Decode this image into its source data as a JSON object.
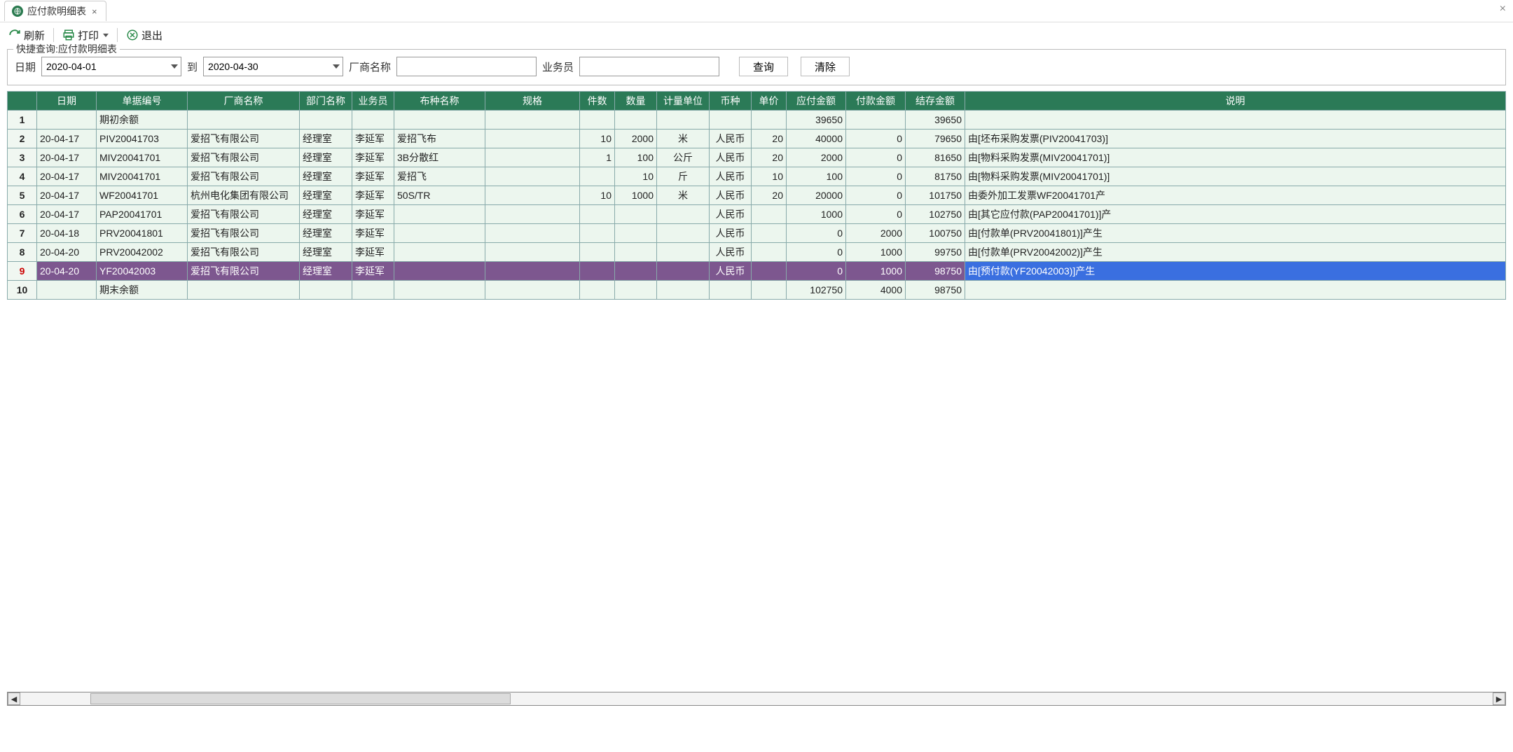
{
  "tab": {
    "title": "应付款明细表"
  },
  "toolbar": {
    "refresh": "刷新",
    "print": "打印",
    "exit": "退出"
  },
  "query": {
    "legend": "快捷查询:应付款明细表",
    "label_date": "日期",
    "date_from": "2020-04-01",
    "label_to": "到",
    "date_to": "2020-04-30",
    "label_supplier": "厂商名称",
    "supplier": "",
    "label_sales": "业务员",
    "sales": "",
    "btn_query": "查询",
    "btn_clear": "清除"
  },
  "grid": {
    "columns": [
      "日期",
      "单据编号",
      "厂商名称",
      "部门名称",
      "业务员",
      "布种名称",
      "规格",
      "件数",
      "数量",
      "计量单位",
      "币种",
      "单价",
      "应付金额",
      "付款金额",
      "结存金额",
      "说明"
    ],
    "selected_row": 9,
    "rows": [
      {
        "n": 1,
        "date": "",
        "doc": "期初余额",
        "supplier": "",
        "dept": "",
        "sales": "",
        "cloth": "",
        "spec": "",
        "pcs": "",
        "qty": "",
        "uom": "",
        "curr": "",
        "price": "",
        "pay": "39650",
        "paid": "",
        "bal": "39650",
        "desc": ""
      },
      {
        "n": 2,
        "date": "20-04-17",
        "doc": "PIV20041703",
        "supplier": "爱招飞有限公司",
        "dept": "经理室",
        "sales": "李延军",
        "cloth": "爱招飞布",
        "spec": "",
        "pcs": "10",
        "qty": "2000",
        "uom": "米",
        "curr": "人民币",
        "price": "20",
        "pay": "40000",
        "paid": "0",
        "bal": "79650",
        "desc": "由[坯布采购发票(PIV20041703)]"
      },
      {
        "n": 3,
        "date": "20-04-17",
        "doc": "MIV20041701",
        "supplier": "爱招飞有限公司",
        "dept": "经理室",
        "sales": "李延军",
        "cloth": "3B分散红",
        "spec": "",
        "pcs": "1",
        "qty": "100",
        "uom": "公斤",
        "curr": "人民币",
        "price": "20",
        "pay": "2000",
        "paid": "0",
        "bal": "81650",
        "desc": "由[物料采购发票(MIV20041701)]"
      },
      {
        "n": 4,
        "date": "20-04-17",
        "doc": "MIV20041701",
        "supplier": "爱招飞有限公司",
        "dept": "经理室",
        "sales": "李延军",
        "cloth": "爱招飞",
        "spec": "",
        "pcs": "",
        "qty": "10",
        "uom": "斤",
        "curr": "人民币",
        "price": "10",
        "pay": "100",
        "paid": "0",
        "bal": "81750",
        "desc": "由[物料采购发票(MIV20041701)]"
      },
      {
        "n": 5,
        "date": "20-04-17",
        "doc": "WF20041701",
        "supplier": "杭州电化集团有限公司",
        "dept": "经理室",
        "sales": "李延军",
        "cloth": "50S/TR",
        "spec": "",
        "pcs": "10",
        "qty": "1000",
        "uom": "米",
        "curr": "人民币",
        "price": "20",
        "pay": "20000",
        "paid": "0",
        "bal": "101750",
        "desc": "由委外加工发票WF20041701产"
      },
      {
        "n": 6,
        "date": "20-04-17",
        "doc": "PAP20041701",
        "supplier": "爱招飞有限公司",
        "dept": "经理室",
        "sales": "李延军",
        "cloth": "",
        "spec": "",
        "pcs": "",
        "qty": "",
        "uom": "",
        "curr": "人民币",
        "price": "",
        "pay": "1000",
        "paid": "0",
        "bal": "102750",
        "desc": "由[其它应付款(PAP20041701)]产"
      },
      {
        "n": 7,
        "date": "20-04-18",
        "doc": "PRV20041801",
        "supplier": "爱招飞有限公司",
        "dept": "经理室",
        "sales": "李延军",
        "cloth": "",
        "spec": "",
        "pcs": "",
        "qty": "",
        "uom": "",
        "curr": "人民币",
        "price": "",
        "pay": "0",
        "paid": "2000",
        "bal": "100750",
        "desc": "由[付款单(PRV20041801)]产生"
      },
      {
        "n": 8,
        "date": "20-04-20",
        "doc": "PRV20042002",
        "supplier": "爱招飞有限公司",
        "dept": "经理室",
        "sales": "李延军",
        "cloth": "",
        "spec": "",
        "pcs": "",
        "qty": "",
        "uom": "",
        "curr": "人民币",
        "price": "",
        "pay": "0",
        "paid": "1000",
        "bal": "99750",
        "desc": "由[付款单(PRV20042002)]产生"
      },
      {
        "n": 9,
        "date": "20-04-20",
        "doc": "YF20042003",
        "supplier": "爱招飞有限公司",
        "dept": "经理室",
        "sales": "李延军",
        "cloth": "",
        "spec": "",
        "pcs": "",
        "qty": "",
        "uom": "",
        "curr": "人民币",
        "price": "",
        "pay": "0",
        "paid": "1000",
        "bal": "98750",
        "desc": "由[预付款(YF20042003)]产生"
      },
      {
        "n": 10,
        "date": "",
        "doc": "期末余额",
        "supplier": "",
        "dept": "",
        "sales": "",
        "cloth": "",
        "spec": "",
        "pcs": "",
        "qty": "",
        "uom": "",
        "curr": "",
        "price": "",
        "pay": "102750",
        "paid": "4000",
        "bal": "98750",
        "desc": ""
      }
    ]
  }
}
